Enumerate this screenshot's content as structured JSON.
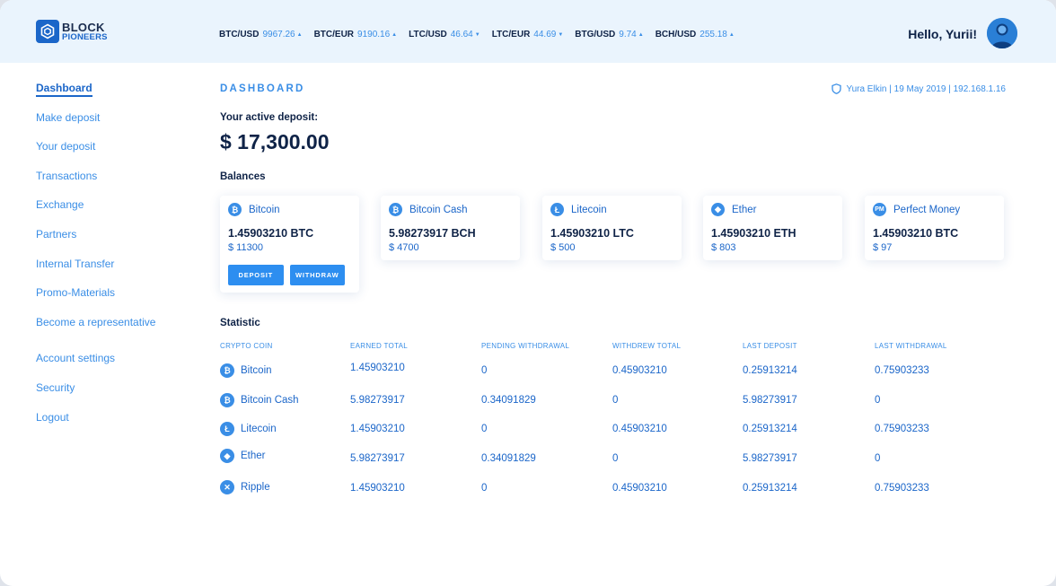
{
  "brand": {
    "line1": "BLOCK",
    "line2": "PIONEERS",
    "icon": "hexagon-logo-icon"
  },
  "tickers": [
    {
      "pair": "BTC/USD",
      "price": "9967.26",
      "arrow": "▲",
      "direction": "up"
    },
    {
      "pair": "BTC/EUR",
      "price": "9190.16",
      "arrow": "▲",
      "direction": "up"
    },
    {
      "pair": "LTC/USD",
      "price": "46.64",
      "arrow": "▼",
      "direction": "down"
    },
    {
      "pair": "LTC/EUR",
      "price": "44.69",
      "arrow": "▼",
      "direction": "down"
    },
    {
      "pair": "BTG/USD",
      "price": "9.74",
      "arrow": "▲",
      "direction": "up"
    },
    {
      "pair": "BCH/USD",
      "price": "255.18",
      "arrow": "▲",
      "direction": "up"
    }
  ],
  "header": {
    "greeting": "Hello, Yurii!"
  },
  "sidebar": {
    "items": [
      {
        "label": "Dashboard",
        "active": true
      },
      {
        "label": "Make deposit"
      },
      {
        "label": "Your deposit"
      },
      {
        "label": "Transactions"
      },
      {
        "label": "Exchange"
      },
      {
        "label": "Partners"
      },
      {
        "label": "Internal Transfer"
      },
      {
        "label": "Promo-Materials"
      },
      {
        "label": "Become a representative"
      }
    ],
    "bottom_items": [
      {
        "label": "Account settings"
      },
      {
        "label": "Security"
      },
      {
        "label": "Logout"
      }
    ]
  },
  "main": {
    "title": "DASHBOARD",
    "session": "Yura Elkin | 19 May 2019 | 192.168.1.16",
    "active_deposit_label": "Your active deposit:",
    "active_deposit_amount": "$ 17,300.00",
    "balances_label": "Balances",
    "balances": [
      {
        "name": "Bitcoin",
        "icon": "₿",
        "amount": "1.45903210 BTC",
        "usd": "$ 11300",
        "deposit_label": "DEPOSIT",
        "withdraw_label": "WITHDRAW"
      },
      {
        "name": "Bitcoin Cash",
        "icon": "₿",
        "amount": "5.98273917 BCH",
        "usd": "$ 4700"
      },
      {
        "name": "Litecoin",
        "icon": "Ł",
        "amount": "1.45903210 LTC",
        "usd": "$ 500"
      },
      {
        "name": "Ether",
        "icon": "◆",
        "amount": "1.45903210 ETH",
        "usd": "$ 803"
      },
      {
        "name": "Perfect Money",
        "icon": "PM",
        "amount": "1.45903210 BTC",
        "usd": "$ 97"
      }
    ],
    "statistic_label": "Statistic",
    "statistic_headers": [
      "CRYPTO COIN",
      "EARNED TOTAL",
      "PENDING WITHDRAWAL",
      "WITHDREW TOTAL",
      "LAST DEPOSIT",
      "LAST WITHDRAWAL"
    ],
    "statistic_rows": [
      {
        "coin": "Bitcoin",
        "icon": "₿",
        "earned": "1.45903210",
        "pending": "0",
        "withdrew": "0.45903210",
        "last_deposit": "0.25913214",
        "last_withdrawal": "0.75903233"
      },
      {
        "coin": "Bitcoin Cash",
        "icon": "₿",
        "earned": "5.98273917",
        "pending": "0.34091829",
        "withdrew": "0",
        "last_deposit": "5.98273917",
        "last_withdrawal": "0"
      },
      {
        "coin": "Litecoin",
        "icon": "Ł",
        "earned": "1.45903210",
        "pending": "0",
        "withdrew": "0.45903210",
        "last_deposit": "0.25913214",
        "last_withdrawal": "0.75903233"
      },
      {
        "coin": "Ether",
        "icon": "◆",
        "earned": "5.98273917",
        "pending": "0.34091829",
        "withdrew": "0",
        "last_deposit": "5.98273917",
        "last_withdrawal": "0"
      },
      {
        "coin": "Ripple",
        "icon": "✕",
        "earned": "1.45903210",
        "pending": "0",
        "withdrew": "0.45903210",
        "last_deposit": "0.25913214",
        "last_withdrawal": "0.75903233"
      }
    ]
  },
  "colors": {
    "accent": "#3a8ee6",
    "brand": "#1b66c9",
    "text_dark": "#0f2347",
    "header_bg": "#eaf4fd",
    "button": "#2d8ef0"
  }
}
